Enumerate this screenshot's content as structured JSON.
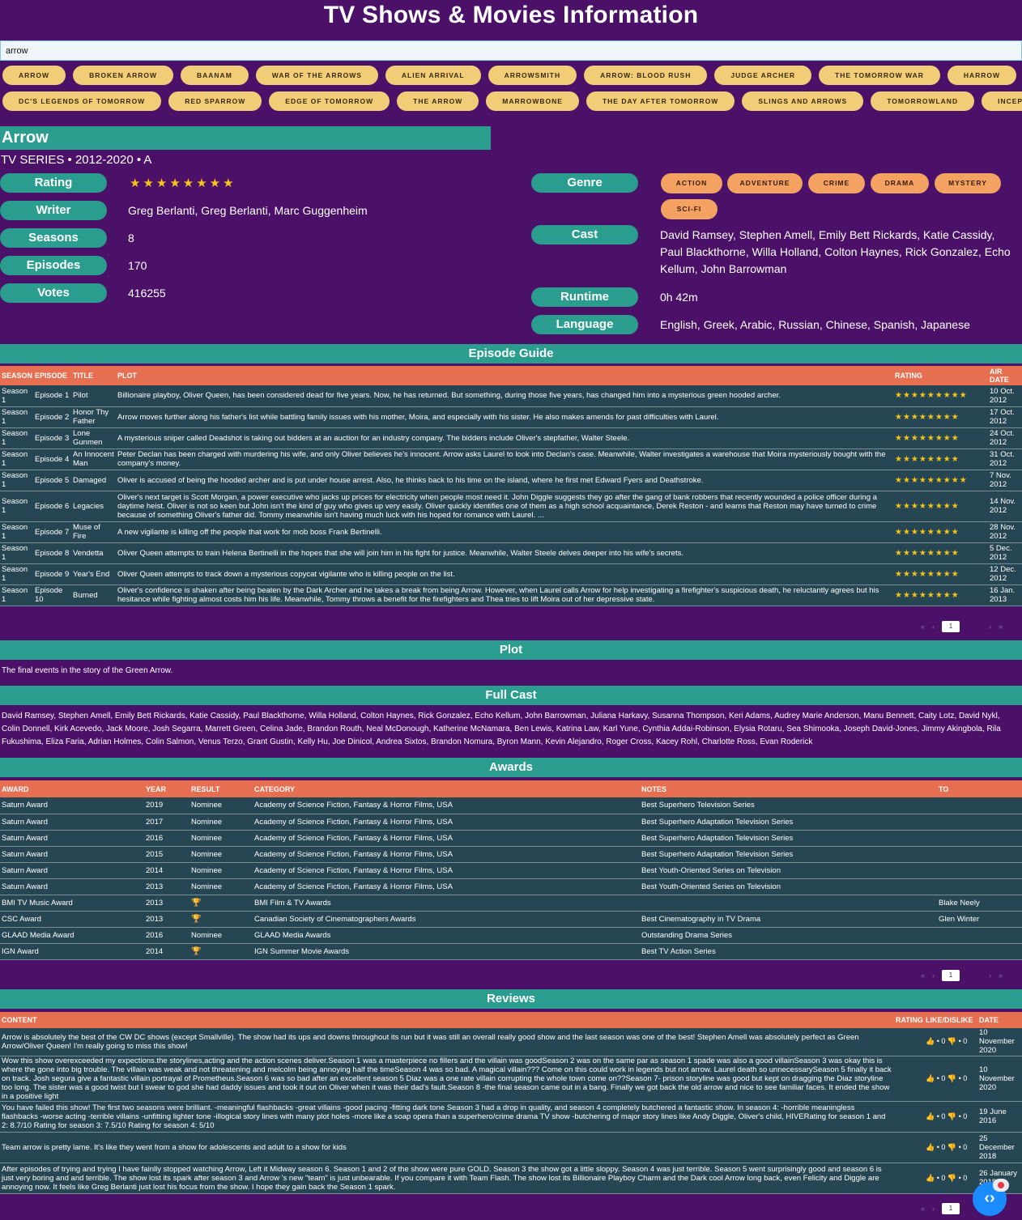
{
  "header": {
    "title": "TV Shows & Movies Information"
  },
  "search": {
    "value": "arrow"
  },
  "suggestions_row1": [
    "ARROW",
    "BROKEN ARROW",
    "BAANAM",
    "WAR OF THE ARROWS",
    "ALIEN ARRIVAL",
    "ARROWSMITH",
    "ARROW: BLOOD RUSH",
    "JUDGE ARCHER",
    "THE TOMORROW WAR",
    "HARROW"
  ],
  "suggestions_row2": [
    "DC'S LEGENDS OF TOMORROW",
    "RED SPARROW",
    "EDGE OF TOMORROW",
    "THE ARROW",
    "MARROWBONE",
    "THE DAY AFTER TOMORROW",
    "SLINGS AND ARROWS",
    "TOMORROWLAND",
    "INCEPTION"
  ],
  "show": {
    "name": "Arrow",
    "meta": "TV SERIES • 2012-2020 • A",
    "labels": {
      "rating": "Rating",
      "writer": "Writer",
      "seasons": "Seasons",
      "episodes": "Episodes",
      "votes": "Votes",
      "genre": "Genre",
      "cast": "Cast",
      "runtime": "Runtime",
      "language": "Language"
    },
    "rating_stars": "★★★★★★★★",
    "writer": "Greg Berlanti, Greg Berlanti, Marc Guggenheim",
    "seasons": "8",
    "episodes": "170",
    "votes": "416255",
    "genres": [
      "ACTION",
      "ADVENTURE",
      "CRIME",
      "DRAMA",
      "MYSTERY",
      "SCI-FI"
    ],
    "cast": "David Ramsey, Stephen Amell, Emily Bett Rickards, Katie Cassidy, Paul Blackthorne, Willa Holland, Colton Haynes, Rick Gonzalez, Echo Kellum, John Barrowman",
    "runtime": "0h 42m",
    "language": "English, Greek, Arabic, Russian, Chinese, Spanish, Japanese"
  },
  "episode_guide": {
    "title": "Episode Guide",
    "headers": {
      "season": "SEASON",
      "episode": "EPISODE",
      "title": "TITLE",
      "plot": "PLOT",
      "rating": "RATING",
      "air": "AIR DATE"
    },
    "rows": [
      {
        "season": "Season 1",
        "episode": "Episode 1",
        "title": "Pilot",
        "plot": "Billionaire playboy, Oliver Queen, has been considered dead for five years. Now, he has returned. But something, during those five years, has changed him into a mysterious green hooded archer.",
        "stars": "★★★★★★★★★",
        "air": "10 Oct. 2012"
      },
      {
        "season": "Season 1",
        "episode": "Episode 2",
        "title": "Honor Thy Father",
        "plot": "Arrow moves further along his father's list while battling family issues with his mother, Moira, and especially with his sister. He also makes amends for past difficulties with Laurel.",
        "stars": "★★★★★★★★",
        "air": "17 Oct. 2012"
      },
      {
        "season": "Season 1",
        "episode": "Episode 3",
        "title": "Lone Gunmen",
        "plot": "A mysterious sniper called Deadshot is taking out bidders at an auction for an industry company. The bidders include Oliver's stepfather, Walter Steele.",
        "stars": "★★★★★★★★",
        "air": "24 Oct. 2012"
      },
      {
        "season": "Season 1",
        "episode": "Episode 4",
        "title": "An Innocent Man",
        "plot": "Peter Declan has been charged with murdering his wife, and only Oliver believes he's innocent. Arrow asks Laurel to look into Declan's case. Meanwhile, Walter investigates a warehouse that Moira mysteriously bought with the company's money.",
        "stars": "★★★★★★★★",
        "air": "31 Oct. 2012"
      },
      {
        "season": "Season 1",
        "episode": "Episode 5",
        "title": "Damaged",
        "plot": "Oliver is accused of being the hooded archer and is put under house arrest. Also, he thinks back to his time on the island, where he first met Edward Fyers and Deathstroke.",
        "stars": "★★★★★★★★★",
        "air": "7 Nov. 2012"
      },
      {
        "season": "Season 1",
        "episode": "Episode 6",
        "title": "Legacies",
        "plot": "Oliver's next target is Scott Morgan, a power executive who jacks up prices for electricity when people most need it. John Diggle suggests they go after the gang of bank robbers that recently wounded a police officer during a daytime heist. Oliver is not so keen but John isn't the kind of guy who gives up very easily. Oliver quickly identifies one of them as a high school acquaintance, Derek Reston - and learns that Reston may have turned to crime because of something Oliver's father did. Tommy meanwhile isn't having much luck with his hoped for romance with Laurel. ...",
        "stars": "★★★★★★★★",
        "air": "14 Nov. 2012"
      },
      {
        "season": "Season 1",
        "episode": "Episode 7",
        "title": "Muse of Fire",
        "plot": "A new vigilante is killing off the people that work for mob boss Frank Bertinelli.",
        "stars": "★★★★★★★★",
        "air": "28 Nov. 2012"
      },
      {
        "season": "Season 1",
        "episode": "Episode 8",
        "title": "Vendetta",
        "plot": "Oliver Queen attempts to train Helena Bertinelli in the hopes that she will join him in his fight for justice. Meanwhile, Walter Steele delves deeper into his wife's secrets.",
        "stars": "★★★★★★★★",
        "air": "5 Dec. 2012"
      },
      {
        "season": "Season 1",
        "episode": "Episode 9",
        "title": "Year's End",
        "plot": "Oliver Queen attempts to track down a mysterious copycat vigilante who is killing people on the list.",
        "stars": "★★★★★★★★",
        "air": "12 Dec. 2012"
      },
      {
        "season": "Season 1",
        "episode": "Episode 10",
        "title": "Burned",
        "plot": "Oliver's confidence is shaken after being beaten by the Dark Archer and he takes a break from being Arrow. However, when Laurel calls Arrow for help investigating a firefighter's suspicious death, he reluctantly agrees but his hesitance while fighting almost costs him his life. Meanwhile, Tommy throws a benefit for the firefighters and Thea tries to lift Moira out of her depressive state.",
        "stars": "★★★★★★★★",
        "air": "16 Jan. 2013"
      }
    ]
  },
  "pager": {
    "first": "«",
    "prev": "‹",
    "page": "1",
    "next": "›",
    "last": "»"
  },
  "plot": {
    "title": "Plot",
    "text": "The final events in the story of the Green Arrow."
  },
  "full_cast": {
    "title": "Full Cast",
    "text": "David Ramsey, Stephen Amell, Emily Bett Rickards, Katie Cassidy, Paul Blackthorne, Willa Holland, Colton Haynes, Rick Gonzalez, Echo Kellum, John Barrowman, Juliana Harkavy, Susanna Thompson, Keri Adams, Audrey Marie Anderson, Manu Bennett, Caity Lotz, David Nykl, Colin Donnell, Kirk Acevedo, Jack Moore, Josh Segarra, Marrett Green, Celina Jade, Brandon Routh, Neal McDonough, Katherine McNamara, Ben Lewis, Katrina Law, Karl Yune, Cynthia Addai-Robinson, Elysia Rotaru, Sea Shimooka, Joseph David-Jones, Jimmy Akingbola, Rila Fukushima, Eliza Faria, Adrian Holmes, Colin Salmon, Venus Terzo, Grant Gustin, Kelly Hu, Joe Dinicol, Andrea Sixtos, Brandon Nomura, Byron Mann, Kevin Alejandro, Roger Cross, Kacey Rohl, Charlotte Ross, Evan Roderick"
  },
  "awards": {
    "title": "Awards",
    "headers": {
      "award": "AWARD",
      "year": "YEAR",
      "result": "RESULT",
      "category": "CATEGORY",
      "notes": "NOTES",
      "to": "TO"
    },
    "rows": [
      {
        "award": "Saturn Award",
        "year": "2019",
        "result": "Nominee",
        "category": "Academy of Science Fiction, Fantasy & Horror Films, USA",
        "notes": "Best Superhero Television Series",
        "to": ""
      },
      {
        "award": "Saturn Award",
        "year": "2017",
        "result": "Nominee",
        "category": "Academy of Science Fiction, Fantasy & Horror Films, USA",
        "notes": "Best Superhero Adaptation Television Series",
        "to": ""
      },
      {
        "award": "Saturn Award",
        "year": "2016",
        "result": "Nominee",
        "category": "Academy of Science Fiction, Fantasy & Horror Films, USA",
        "notes": "Best Superhero Adaptation Television Series",
        "to": ""
      },
      {
        "award": "Saturn Award",
        "year": "2015",
        "result": "Nominee",
        "category": "Academy of Science Fiction, Fantasy & Horror Films, USA",
        "notes": "Best Superhero Adaptation Television Series",
        "to": ""
      },
      {
        "award": "Saturn Award",
        "year": "2014",
        "result": "Nominee",
        "category": "Academy of Science Fiction, Fantasy & Horror Films, USA",
        "notes": "Best Youth-Oriented Series on Television",
        "to": ""
      },
      {
        "award": "Saturn Award",
        "year": "2013",
        "result": "Nominee",
        "category": "Academy of Science Fiction, Fantasy & Horror Films, USA",
        "notes": "Best Youth-Oriented Series on Television",
        "to": ""
      },
      {
        "award": "BMI TV Music Award",
        "year": "2013",
        "result": "🏆",
        "category": "BMI Film & TV Awards",
        "notes": "",
        "to": "Blake Neely"
      },
      {
        "award": "CSC Award",
        "year": "2013",
        "result": "🏆",
        "category": "Canadian Society of Cinematographers Awards",
        "notes": "Best Cinematography in TV Drama",
        "to": "Glen Winter"
      },
      {
        "award": "GLAAD Media Award",
        "year": "2016",
        "result": "Nominee",
        "category": "GLAAD Media Awards",
        "notes": "Outstanding Drama Series",
        "to": ""
      },
      {
        "award": "IGN Award",
        "year": "2014",
        "result": "🏆",
        "category": "IGN Summer Movie Awards",
        "notes": "Best TV Action Series",
        "to": ""
      }
    ]
  },
  "reviews": {
    "title": "Reviews",
    "headers": {
      "content": "CONTENT",
      "rating": "RATING",
      "like": "LIKE/DISLIKE",
      "date": "DATE"
    },
    "rows": [
      {
        "content": "Arrow is absolutely the best of the CW DC shows (except Smallville). The show had its ups and downs throughout its run but it was still an overall really good show and the last season was one of the best! Stephen Amell was absolutely perfect as Green Arrow/Oliver Queen! I'm really going to miss this show!",
        "likes": "0",
        "dislikes": "0",
        "date": "10 November 2020"
      },
      {
        "content": "Wow this show overexceeded my expections.the storylines,acting and the action scenes deliver.Season 1 was a masterpiece no fillers and the villain was goodSeason 2 was on the same par as season 1 spade was also a good villainSeason 3 was okay this is where the gone into big trouble. The villain was weak and not threatening and melcolm being annoying half the timeSeason 4 was so bad. A magical villain??? Come on this could work in legends but not arrow. Laurel death so unnecessarySeason 5 finally it back on track. Josh segura give a fantastic villain portrayal of Prometheus.Season 6 was so bad after an excellent season 5 Diaz was a one rate villain corrupting the whole town come on??Season 7- prison storyline was good but kept on dragging the Diaz storyline too long. The sister was a good twist but I swear to god she had daddy issues and took it out on Oliver when it was their dad's fault.Season 8 -the final season came out in a bang. Finally we got back the old arrow and nice to see familiar faces. It ended the show in a positive light",
        "likes": "0",
        "dislikes": "0",
        "date": "10 November 2020"
      },
      {
        "content": "You have failed this show! The first two seasons were brilliant. -meaningful flashbacks -great villains -good pacing -fitting dark tone Season 3 had a drop in quality, and season 4 completely butchered a fantastic show. In season 4: -horrible meaningless flashbacks -worse acting -terrible villains -unfitting lighter tone -illogical story lines with many plot holes -more like a soap opera than a superhero/crime drama TV show -butchering of major story lines like Andy Diggle, Oliver's child, HIVERating for season 1 and 2: 8.7/10 Rating for season 3: 7.5/10 Rating for season 4: 5/10",
        "likes": "0",
        "dislikes": "0",
        "date": "19 June 2016"
      },
      {
        "content": "Team arrow is pretty lame. It's like they went from a show for adolescents and adult to a show for kids",
        "likes": "0",
        "dislikes": "0",
        "date": "25 December 2018"
      },
      {
        "content": "After episodes of trying and trying I have fainlly stopped watching Arrow, Left it Midway season 6. Season 1 and 2 of the show were pure GOLD. Season 3 the show got a little sloppy. Season 4 was just terrible. Season 5 went surprisingly good and season 6 is just very boring and and terrible. The show lost its spark after season 3 and Arrow 's new \"team\" is just unbearable. If you compare it with Team Flash. The show lost its Billionaire Playboy Charm and the Dark cool Arrow long back, even Felicity and Diggle are annoying now. It feels like Greg Berlanti just lost his focus from the show. I hope they gain back the Season 1 spark.",
        "likes": "0",
        "dislikes": "0",
        "date": "26 January 2018"
      }
    ]
  },
  "colors": {
    "background": "#4b1169",
    "teal": "#2a9d8f",
    "orange": "#e76f51",
    "gold": "#f0cd76",
    "genre": "#f4a261",
    "row": "#264653"
  }
}
